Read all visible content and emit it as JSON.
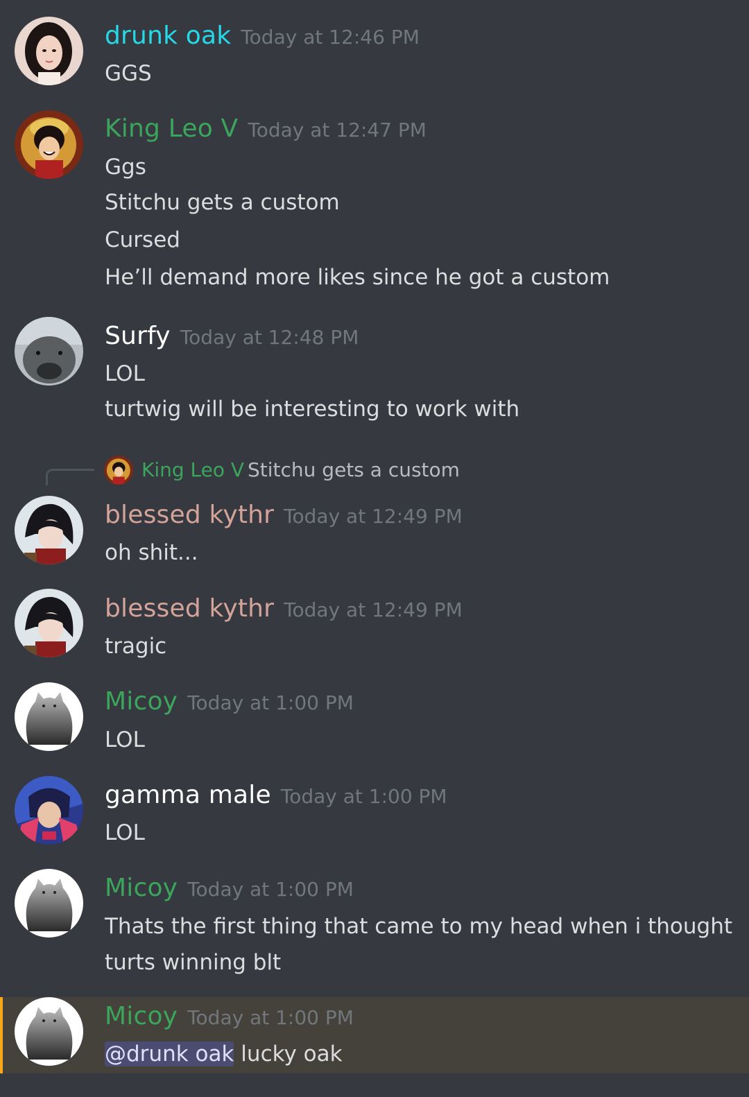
{
  "colors": {
    "background": "#36393f",
    "timestamp": "#72767d",
    "text": "#dcddde",
    "mention_bg": "#4a4f8a",
    "highlight_bg": "#45423b",
    "highlight_bar": "#faa81a"
  },
  "messages": [
    {
      "author": "drunk oak",
      "author_color": "#26d9e9",
      "timestamp": "Today at 12:46 PM",
      "lines": [
        "GGS"
      ],
      "avatar_icon": "user-avatar-icon"
    },
    {
      "author": "King Leo V",
      "author_color": "#3ba55c",
      "timestamp": "Today at 12:47 PM",
      "lines": [
        "Ggs",
        "Stitchu gets a custom",
        "Cursed",
        "He’ll demand more likes since he got a custom"
      ],
      "avatar_icon": "user-avatar-icon"
    },
    {
      "author": "Surfy",
      "author_color": "#ffffff",
      "timestamp": "Today at 12:48 PM",
      "lines": [
        "LOL",
        "turtwig will be interesting to work with"
      ],
      "avatar_icon": "user-avatar-icon"
    },
    {
      "author": "blessed kythr",
      "author_color": "#d4a39a",
      "timestamp": "Today at 12:49 PM",
      "lines": [
        "oh shit..."
      ],
      "avatar_icon": "user-avatar-icon",
      "reply": {
        "author": "King Leo V",
        "text": "Stitchu gets a custom"
      }
    },
    {
      "author": "blessed kythr",
      "author_color": "#d4a39a",
      "timestamp": "Today at 12:49 PM",
      "lines": [
        "tragic"
      ],
      "avatar_icon": "user-avatar-icon"
    },
    {
      "author": "Micoy",
      "author_color": "#3ba55c",
      "timestamp": "Today at 1:00 PM",
      "lines": [
        "LOL"
      ],
      "avatar_icon": "user-avatar-icon"
    },
    {
      "author": "gamma male",
      "author_color": "#ffffff",
      "timestamp": "Today at 1:00 PM",
      "lines": [
        "LOL"
      ],
      "avatar_icon": "user-avatar-icon"
    },
    {
      "author": "Micoy",
      "author_color": "#3ba55c",
      "timestamp": "Today at 1:00 PM",
      "lines": [
        "Thats the first thing that came to my head when i thought",
        "turts winning blt"
      ],
      "avatar_icon": "user-avatar-icon"
    },
    {
      "author": "Micoy",
      "author_color": "#3ba55c",
      "timestamp": "Today at 1:00 PM",
      "mention": "@drunk oak",
      "lines": [
        " lucky oak"
      ],
      "avatar_icon": "user-avatar-icon",
      "highlighted": true
    }
  ]
}
